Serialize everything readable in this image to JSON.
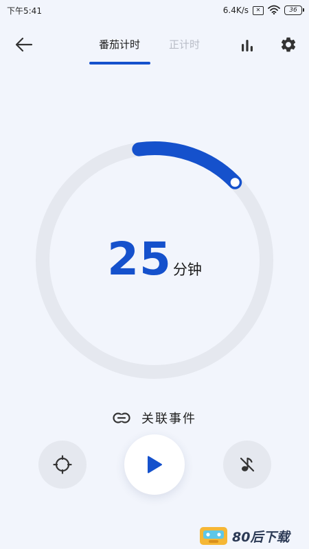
{
  "status_bar": {
    "time": "下午5:41",
    "network_speed": "6.4K/s",
    "sim_icon": "sim-x-icon",
    "sim_glyph": "✕",
    "wifi_icon": "wifi-icon",
    "battery_level": "36"
  },
  "top_bar": {
    "back_icon": "arrow-left-icon",
    "tabs": [
      {
        "label": "番茄计时",
        "active": true
      },
      {
        "label": "正计时",
        "active": false
      }
    ],
    "stats_icon": "bar-chart-icon",
    "settings_icon": "gear-icon"
  },
  "timer": {
    "value": "25",
    "unit": "分钟",
    "progress_fraction": 0.15,
    "ring_color": "#e5e8ef",
    "progress_color": "#1551cc"
  },
  "link_event": {
    "icon": "link-icon",
    "label": "关联事件"
  },
  "controls": {
    "focus_icon": "crosshair-icon",
    "play_icon": "play-icon",
    "music_icon": "music-off-icon"
  },
  "watermark": {
    "text": "80后下载"
  },
  "colors": {
    "accent": "#1551cc",
    "background": "#f2f5fc",
    "inactive_tab": "#b8bcc6"
  }
}
